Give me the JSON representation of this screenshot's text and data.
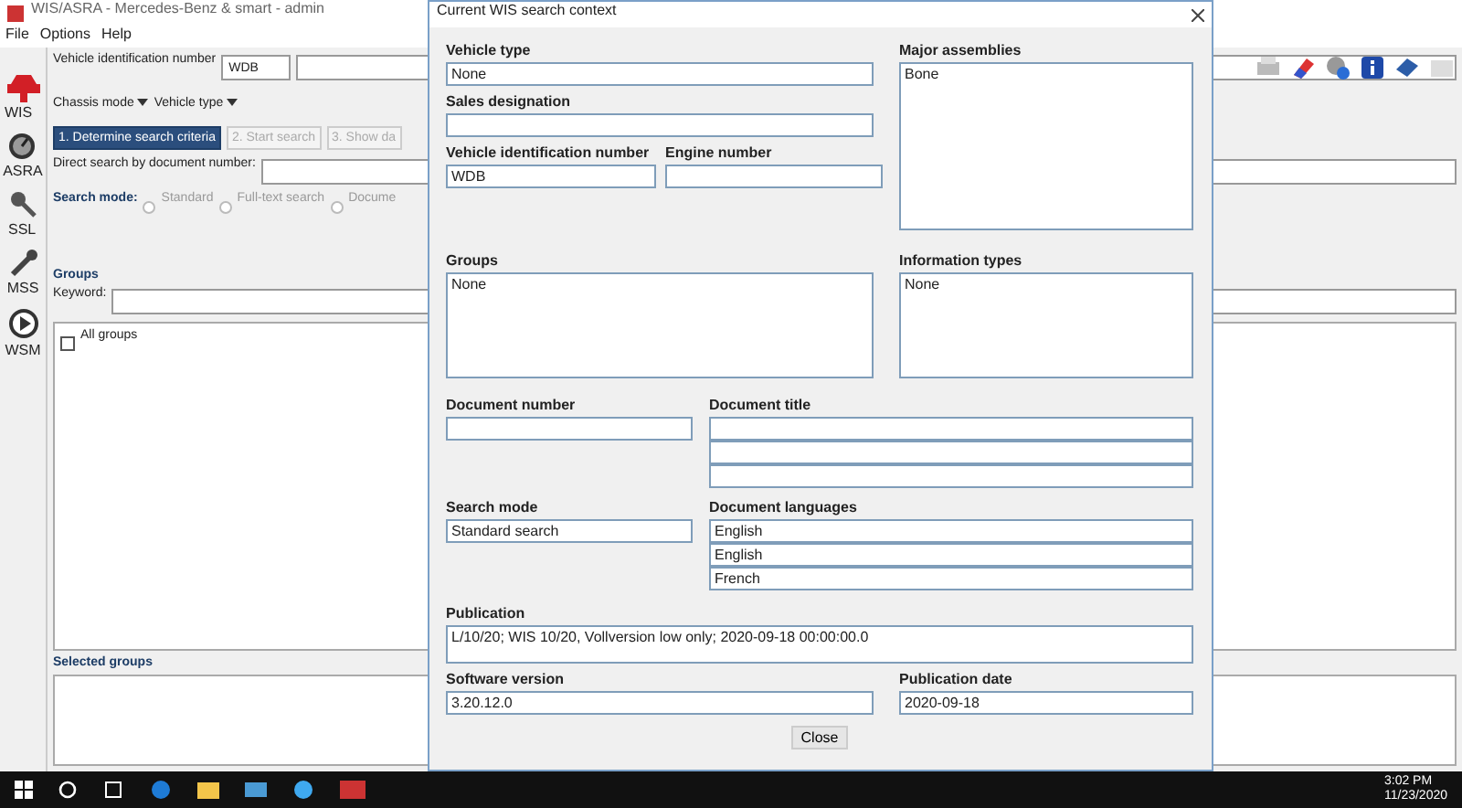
{
  "app": {
    "title": "WIS/ASRA - Mercedes-Benz & smart - admin",
    "menu": [
      "File",
      "Options",
      "Help"
    ],
    "sidebar": [
      "WIS",
      "ASRA",
      "SSL",
      "MSS",
      "WSM"
    ],
    "vin_label": "Vehicle identification number",
    "vin_prefix": "WDB",
    "modes": [
      "Chassis mode",
      "Vehicle type"
    ],
    "steps": [
      {
        "label": "1. Determine search criteria",
        "selected": true
      },
      {
        "label": "2. Start search",
        "selected": false
      },
      {
        "label": "3. Show da",
        "selected": false
      }
    ],
    "direct_search_label": "Direct search by document number:",
    "search_mode_label": "Search mode:",
    "search_modes": [
      {
        "label": "Standard",
        "selected": false
      },
      {
        "label": "Full-text search",
        "selected": false
      },
      {
        "label": "Docume",
        "selected": false
      }
    ],
    "groups_title": "Groups",
    "keyword_label": "Keyword:",
    "tree": [
      {
        "label": "All groups",
        "checked": false
      }
    ],
    "selected_groups_title": "Selected groups"
  },
  "dialog": {
    "title": "Current WIS search context",
    "vehicle_type": {
      "label": "Vehicle type",
      "value": "None"
    },
    "sales_designation": {
      "label": "Sales designation"
    },
    "vin": {
      "label": "Vehicle identification number",
      "value": "WDB"
    },
    "engine_number": {
      "label": "Engine number"
    },
    "major_assemblies": {
      "label": "Major assemblies",
      "value": "Bone"
    },
    "groups": {
      "label": "Groups",
      "value": "None"
    },
    "information_types": {
      "label": "Information types",
      "value": "None"
    },
    "document_number": {
      "label": "Document number"
    },
    "document_title": {
      "label": "Document title"
    },
    "search_mode": {
      "label": "Search mode",
      "value": "Standard search"
    },
    "document_languages": {
      "label": "Document languages",
      "values": [
        "English",
        "English",
        "French"
      ]
    },
    "publication": {
      "label": "Publication",
      "value": "L/10/20; WIS 10/20, Vollversion low only; 2020-09-18 00:00:00.0"
    },
    "software_version": {
      "label": "Software version",
      "value": "3.20.12.0"
    },
    "publication_date": {
      "label": "Publication date",
      "value": "2020-09-18"
    },
    "close_button": "Close"
  },
  "taskbar": {
    "time": "3:02 PM",
    "date": "11/23/2020"
  }
}
